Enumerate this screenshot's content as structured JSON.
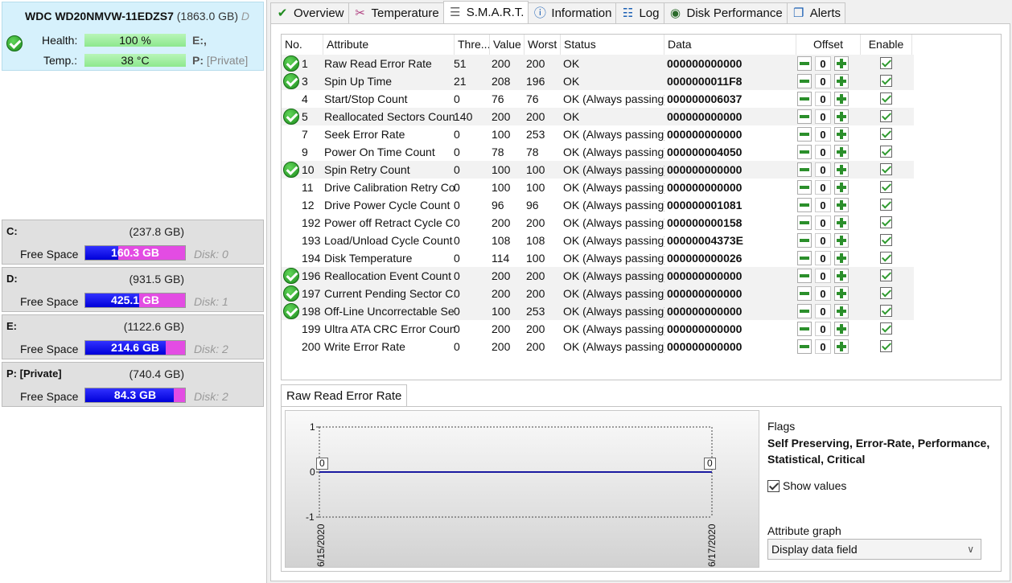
{
  "disk": {
    "model": "WDC WD20NMVW-11EDZS7",
    "size": "(1863.0 GB)",
    "trunc": "D",
    "health_label": "Health:",
    "health_value": "100 %",
    "temp_label": "Temp.:",
    "temp_value": "38 °C",
    "letter1": "E:,",
    "letter2": "P:",
    "letter2_name": "[Private]"
  },
  "volumes": [
    {
      "name": "C:",
      "size": "(237.8 GB)",
      "free_label": "Free Space",
      "free": "160.3 GB",
      "used_fraction": 0.33,
      "disk": "Disk: 0"
    },
    {
      "name": "D:",
      "size": "(931.5 GB)",
      "free_label": "Free Space",
      "free": "425.1 GB",
      "used_fraction": 0.54,
      "disk": "Disk: 1"
    },
    {
      "name": "E:",
      "size": "(1122.6 GB)",
      "free_label": "Free Space",
      "free": "214.6 GB",
      "used_fraction": 0.81,
      "disk": "Disk: 2"
    },
    {
      "name": "P: [Private]",
      "size": "(740.4 GB)",
      "free_label": "Free Space",
      "free": "84.3 GB",
      "used_fraction": 0.89,
      "disk": "Disk: 2"
    }
  ],
  "tabs": [
    {
      "label": "Overview",
      "icon": "check-icon"
    },
    {
      "label": "Temperature",
      "icon": "thermometer-icon"
    },
    {
      "label": "S.M.A.R.T.",
      "icon": "smart-icon"
    },
    {
      "label": "Information",
      "icon": "info-icon"
    },
    {
      "label": "Log",
      "icon": "log-icon"
    },
    {
      "label": "Disk Performance",
      "icon": "gauge-icon"
    },
    {
      "label": "Alerts",
      "icon": "alerts-icon"
    }
  ],
  "table": {
    "headers": {
      "no": "No.",
      "attribute": "Attribute",
      "thresh": "Thre...",
      "value": "Value",
      "worst": "Worst",
      "status": "Status",
      "data": "Data",
      "offset": "Offset",
      "enable": "Enable"
    },
    "rows": [
      {
        "icon": true,
        "no": "1",
        "attr": "Raw Read Error Rate",
        "thr": "51",
        "val": "200",
        "worst": "200",
        "status": "OK",
        "data": "000000000000",
        "offset": "0"
      },
      {
        "icon": true,
        "no": "3",
        "attr": "Spin Up Time",
        "thr": "21",
        "val": "208",
        "worst": "196",
        "status": "OK",
        "data": "0000000011F8",
        "offset": "0"
      },
      {
        "icon": false,
        "no": "4",
        "attr": "Start/Stop Count",
        "thr": "0",
        "val": "76",
        "worst": "76",
        "status": "OK (Always passing)",
        "data": "000000006037",
        "offset": "0"
      },
      {
        "icon": true,
        "no": "5",
        "attr": "Reallocated Sectors Count",
        "thr": "140",
        "val": "200",
        "worst": "200",
        "status": "OK",
        "data": "000000000000",
        "offset": "0"
      },
      {
        "icon": false,
        "no": "7",
        "attr": "Seek Error Rate",
        "thr": "0",
        "val": "100",
        "worst": "253",
        "status": "OK (Always passing)",
        "data": "000000000000",
        "offset": "0"
      },
      {
        "icon": false,
        "no": "9",
        "attr": "Power On Time Count",
        "thr": "0",
        "val": "78",
        "worst": "78",
        "status": "OK (Always passing)",
        "data": "000000004050",
        "offset": "0"
      },
      {
        "icon": true,
        "no": "10",
        "attr": "Spin Retry Count",
        "thr": "0",
        "val": "100",
        "worst": "100",
        "status": "OK (Always passing)",
        "data": "000000000000",
        "offset": "0"
      },
      {
        "icon": false,
        "no": "11",
        "attr": "Drive Calibration Retry Co...",
        "thr": "0",
        "val": "100",
        "worst": "100",
        "status": "OK (Always passing)",
        "data": "000000000000",
        "offset": "0"
      },
      {
        "icon": false,
        "no": "12",
        "attr": "Drive Power Cycle Count",
        "thr": "0",
        "val": "96",
        "worst": "96",
        "status": "OK (Always passing)",
        "data": "000000001081",
        "offset": "0"
      },
      {
        "icon": false,
        "no": "192",
        "attr": "Power off Retract Cycle C...",
        "thr": "0",
        "val": "200",
        "worst": "200",
        "status": "OK (Always passing)",
        "data": "000000000158",
        "offset": "0"
      },
      {
        "icon": false,
        "no": "193",
        "attr": "Load/Unload Cycle Count",
        "thr": "0",
        "val": "108",
        "worst": "108",
        "status": "OK (Always passing)",
        "data": "00000004373E",
        "offset": "0"
      },
      {
        "icon": false,
        "no": "194",
        "attr": "Disk Temperature",
        "thr": "0",
        "val": "114",
        "worst": "100",
        "status": "OK (Always passing)",
        "data": "000000000026",
        "offset": "0"
      },
      {
        "icon": true,
        "no": "196",
        "attr": "Reallocation Event Count",
        "thr": "0",
        "val": "200",
        "worst": "200",
        "status": "OK (Always passing)",
        "data": "000000000000",
        "offset": "0"
      },
      {
        "icon": true,
        "no": "197",
        "attr": "Current Pending Sector C...",
        "thr": "0",
        "val": "200",
        "worst": "200",
        "status": "OK (Always passing)",
        "data": "000000000000",
        "offset": "0"
      },
      {
        "icon": true,
        "no": "198",
        "attr": "Off-Line Uncorrectable Se...",
        "thr": "0",
        "val": "100",
        "worst": "253",
        "status": "OK (Always passing)",
        "data": "000000000000",
        "offset": "0"
      },
      {
        "icon": false,
        "no": "199",
        "attr": "Ultra ATA CRC Error Count",
        "thr": "0",
        "val": "200",
        "worst": "200",
        "status": "OK (Always passing)",
        "data": "000000000000",
        "offset": "0"
      },
      {
        "icon": false,
        "no": "200",
        "attr": "Write Error Rate",
        "thr": "0",
        "val": "200",
        "worst": "200",
        "status": "OK (Always passing)",
        "data": "000000000000",
        "offset": "0"
      }
    ]
  },
  "graph": {
    "tab_label": "Raw Read Error Rate",
    "y_ticks": [
      "1",
      "0",
      "-1"
    ],
    "start_value": "0",
    "end_value": "0",
    "x_start": "6/15/2020",
    "x_end": "6/17/2020",
    "line_color": "#1a1aa0"
  },
  "flags": {
    "title": "Flags",
    "value": "Self Preserving, Error-Rate, Performance, Statistical, Critical"
  },
  "show_values": {
    "label": "Show values",
    "checked": true
  },
  "attr_graph": {
    "label": "Attribute graph",
    "selected": "Display data field"
  }
}
